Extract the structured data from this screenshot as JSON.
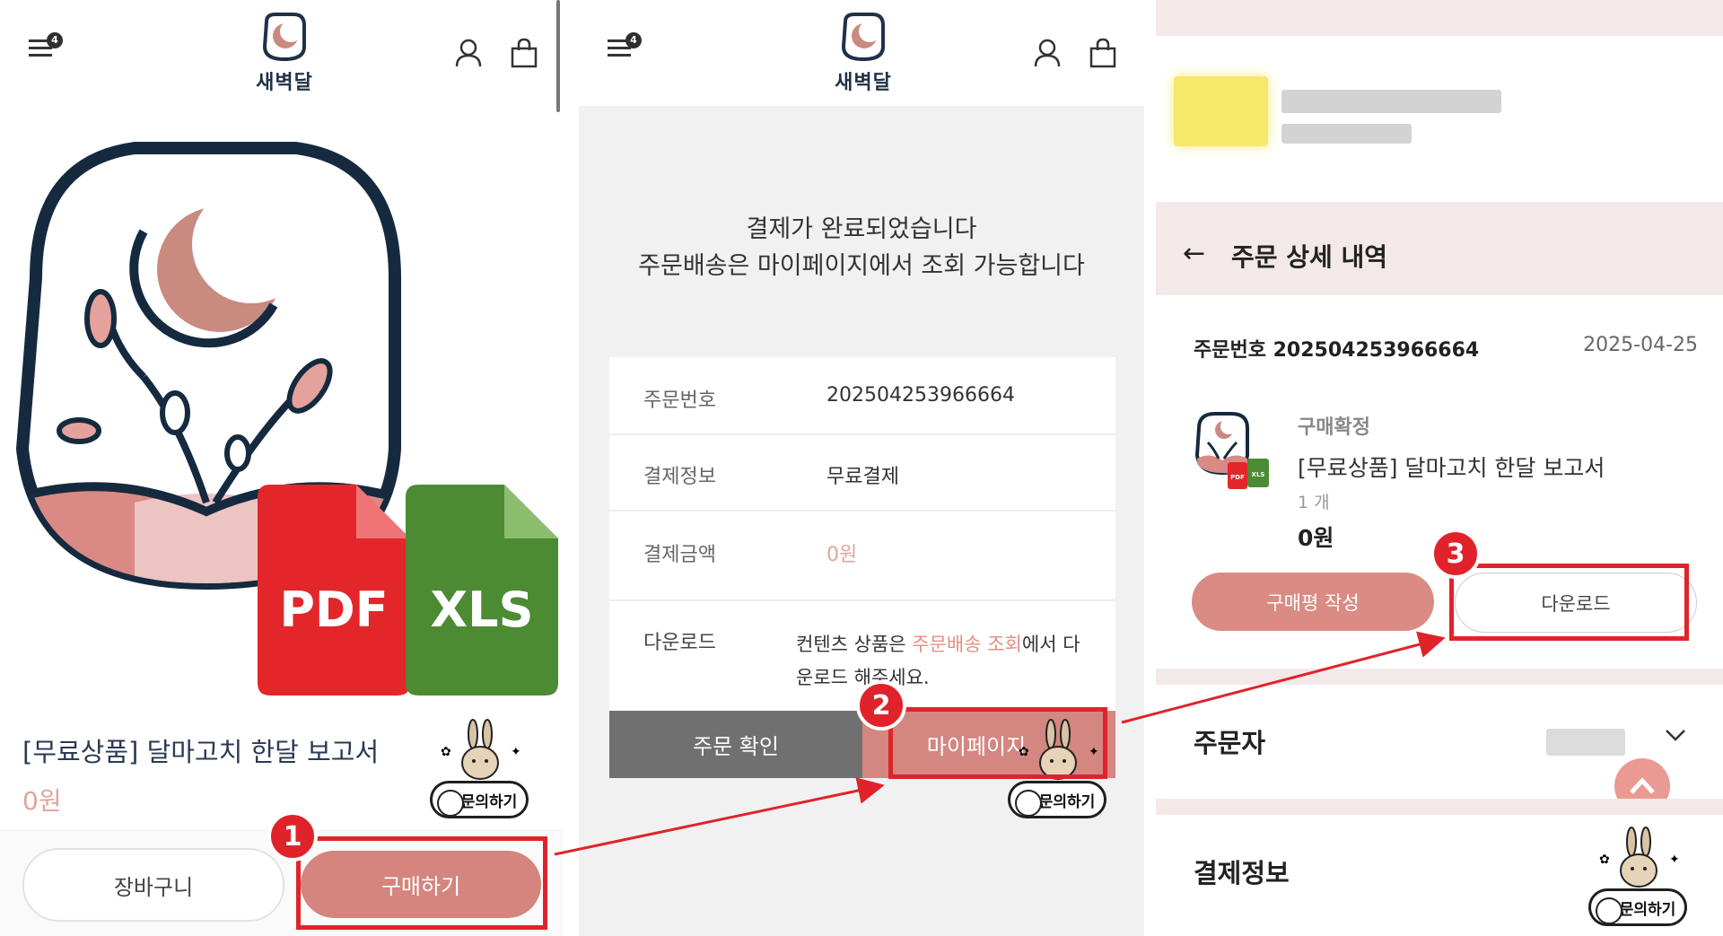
{
  "colors": {
    "accent": "#d4857e",
    "highlight": "#e0232a",
    "navy": "#1f3147",
    "price": "#e0a49a"
  },
  "common": {
    "menu_badge": "4",
    "logo_text": "새벽달",
    "inquiry_label": "문의하기"
  },
  "screen1": {
    "product_title": "[무료상품] 달마고치 한달 보고서",
    "product_price": "0원",
    "cart_button": "장바구니",
    "buy_button": "구매하기",
    "file_badges": [
      "PDF",
      "XLS"
    ]
  },
  "screen2": {
    "message_line1": "결제가 완료되었습니다",
    "message_line2": "주문배송은 마이페이지에서 조회 가능합니다",
    "rows": [
      {
        "label": "주문번호",
        "value": "202504253966664"
      },
      {
        "label": "결제정보",
        "value": "무료결제"
      },
      {
        "label": "결제금액",
        "value": "0원"
      }
    ],
    "download_label": "다운로드",
    "download_text_before": "컨텐츠 상품은 ",
    "download_link": "주문배송 조회",
    "download_text_after": "에서 다운로드 해주세요.",
    "confirm_button": "주문 확인",
    "mypage_button": "마이페이지"
  },
  "screen3": {
    "header_title": "주문 상세 내역",
    "order_number": "주문번호 202504253966664",
    "order_date": "2025-04-25",
    "status": "구매확정",
    "item_name": "[무료상품] 달마고치 한달 보고서",
    "item_qty": "1 개",
    "item_price": "0원",
    "review_button": "구매평 작성",
    "download_button": "다운로드",
    "orderer_section": "주문자",
    "payment_section": "결제정보"
  },
  "steps": [
    "1",
    "2",
    "3"
  ]
}
